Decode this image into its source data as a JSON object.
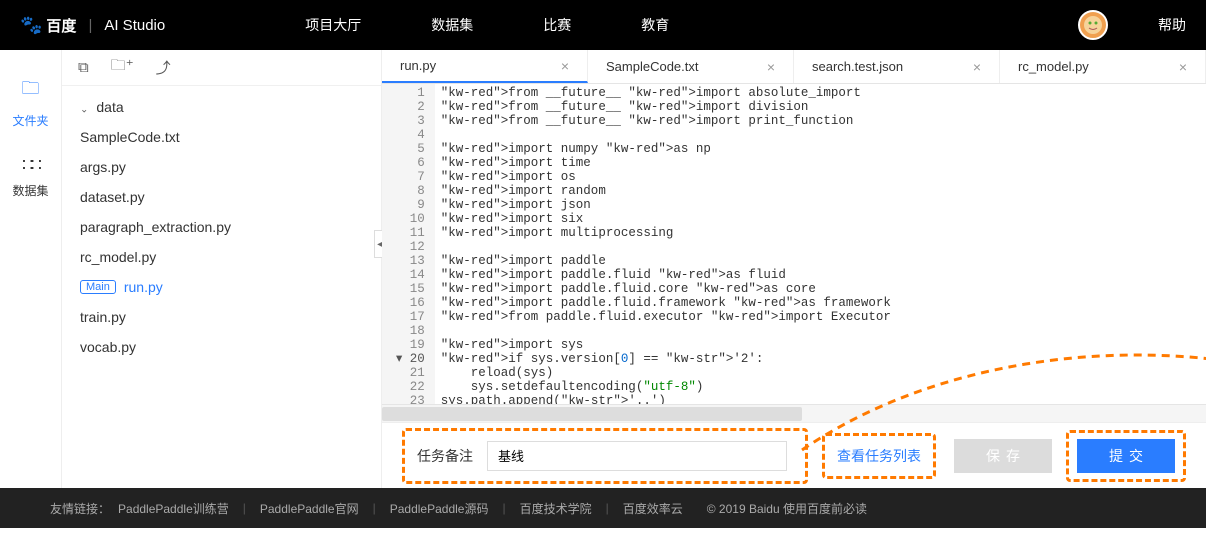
{
  "header": {
    "brand_baidu": "百度",
    "brand_studio": "AI Studio",
    "nav": {
      "projects": "项目大厅",
      "datasets": "数据集",
      "competition": "比赛",
      "education": "教育"
    },
    "help": "帮助"
  },
  "leftrail": {
    "files": "文件夹",
    "datasets": "数据集"
  },
  "filetree": {
    "folder_data": "data",
    "files": {
      "samplecode": "SampleCode.txt",
      "args": "args.py",
      "dataset": "dataset.py",
      "paragraph": "paragraph_extraction.py",
      "rcmodel": "rc_model.py",
      "run": "run.py",
      "train": "train.py",
      "vocab": "vocab.py"
    },
    "main_tag": "Main"
  },
  "tabs": {
    "t1": "run.py",
    "t2": "SampleCode.txt",
    "t3": "search.test.json",
    "t4": "rc_model.py"
  },
  "code_lines": [
    "from __future__ import absolute_import",
    "from __future__ import division",
    "from __future__ import print_function",
    "",
    "import numpy as np",
    "import time",
    "import os",
    "import random",
    "import json",
    "import six",
    "import multiprocessing",
    "",
    "import paddle",
    "import paddle.fluid as fluid",
    "import paddle.fluid.core as core",
    "import paddle.fluid.framework as framework",
    "from paddle.fluid.executor import Executor",
    "",
    "import sys",
    "if sys.version[0] == '2':",
    "    reload(sys)",
    "    sys.setdefaultencoding(\"utf-8\")",
    "sys.path.append('..')",
    ""
  ],
  "actionbar": {
    "field_label": "任务备注",
    "field_value": "基线",
    "view_tasks": "查看任务列表",
    "save": "保存",
    "submit": "提交"
  },
  "footer": {
    "friendly": "友情链接：",
    "l1": "PaddlePaddle训练营",
    "l2": "PaddlePaddle官网",
    "l3": "PaddlePaddle源码",
    "l4": "百度技术学院",
    "l5": "百度效率云",
    "copyright": "© 2019 Baidu 使用百度前必读"
  }
}
